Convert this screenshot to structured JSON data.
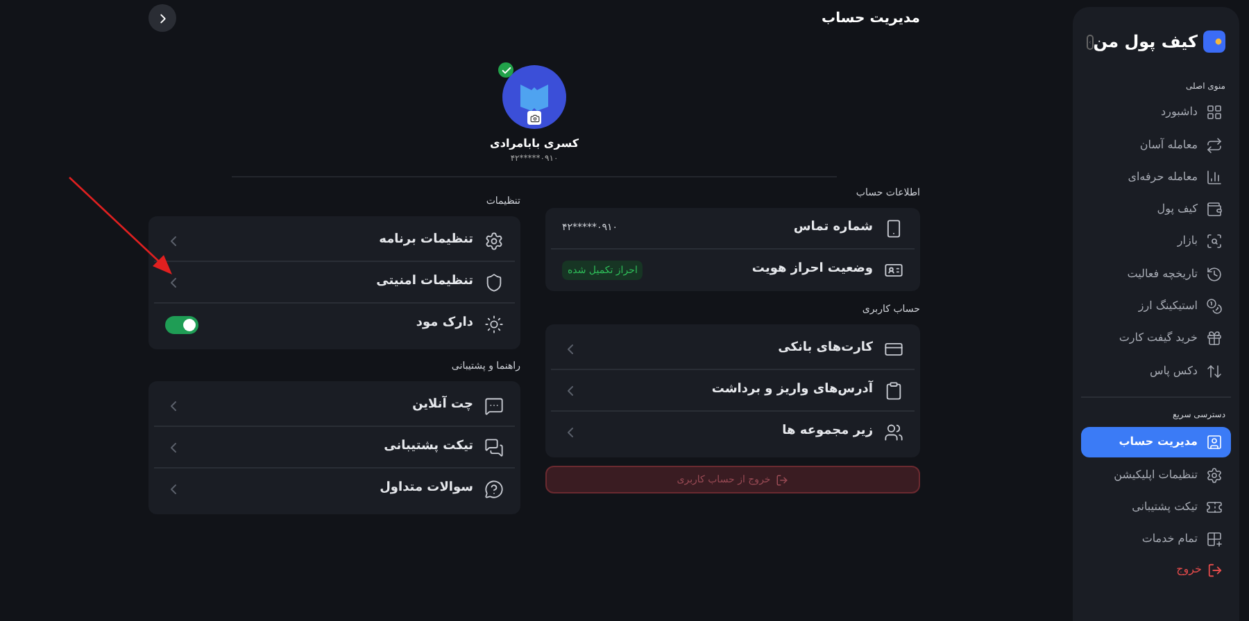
{
  "sidebar": {
    "logo": "کیف پول من",
    "sections": [
      {
        "title": "منوی اصلی",
        "items": [
          {
            "label": "داشبورد",
            "selected": false
          },
          {
            "label": "معامله آسان",
            "selected": false
          },
          {
            "label": "معامله حرفه‌ای",
            "selected": false
          },
          {
            "label": "کیف پول",
            "selected": false
          },
          {
            "label": "بازار",
            "selected": false
          },
          {
            "label": "تاریخچه فعالیت",
            "selected": false
          },
          {
            "label": "استیکینگ ارز",
            "selected": false
          },
          {
            "label": "خرید گیفت کارت",
            "selected": false
          },
          {
            "label": "دکس پاس",
            "selected": false
          }
        ]
      },
      {
        "title": "دسترسی سریع",
        "items": [
          {
            "label": "مدیریت حساب",
            "selected": true
          },
          {
            "label": "تنظیمات اپلیکیشن",
            "selected": false
          },
          {
            "label": "تیکت پشتیبانی",
            "selected": false
          },
          {
            "label": "تمام خدمات",
            "selected": false
          }
        ]
      }
    ],
    "logout": "خروج"
  },
  "page": {
    "title": "مدیریت حساب"
  },
  "profile": {
    "name": "کسری بابامرادی",
    "phone": "۰۹۱۰*****۴۲",
    "verified": true
  },
  "account_info": {
    "title": "اطلاعات حساب",
    "rows": [
      {
        "kind": "value",
        "label": "شماره تماس",
        "value": "۰۹۱۰*****۴۲"
      },
      {
        "kind": "badge",
        "label": "وضعیت احراز هویت",
        "value": "احراز تکمیل شده"
      }
    ]
  },
  "user_account": {
    "title": "حساب کاربری",
    "items": [
      {
        "label": "کارت‌های بانکی"
      },
      {
        "label": "آدرس‌های واریز و برداشت"
      },
      {
        "label": "زیر مجموعه ها"
      }
    ]
  },
  "logout_button": "خروج از حساب کاربری",
  "settings": {
    "title": "تنظیمات",
    "items": [
      {
        "kind": "link",
        "label": "تنظیمات برنامه"
      },
      {
        "kind": "link",
        "label": "تنظیمات امنیتی"
      },
      {
        "kind": "toggle",
        "label": "دارک مود",
        "on": true
      }
    ]
  },
  "support": {
    "title": "راهنما و پشتیبانی",
    "items": [
      {
        "label": "چت آنلاین"
      },
      {
        "label": "تیکت پشتیبانی"
      },
      {
        "label": "سوالات متداول"
      }
    ]
  }
}
